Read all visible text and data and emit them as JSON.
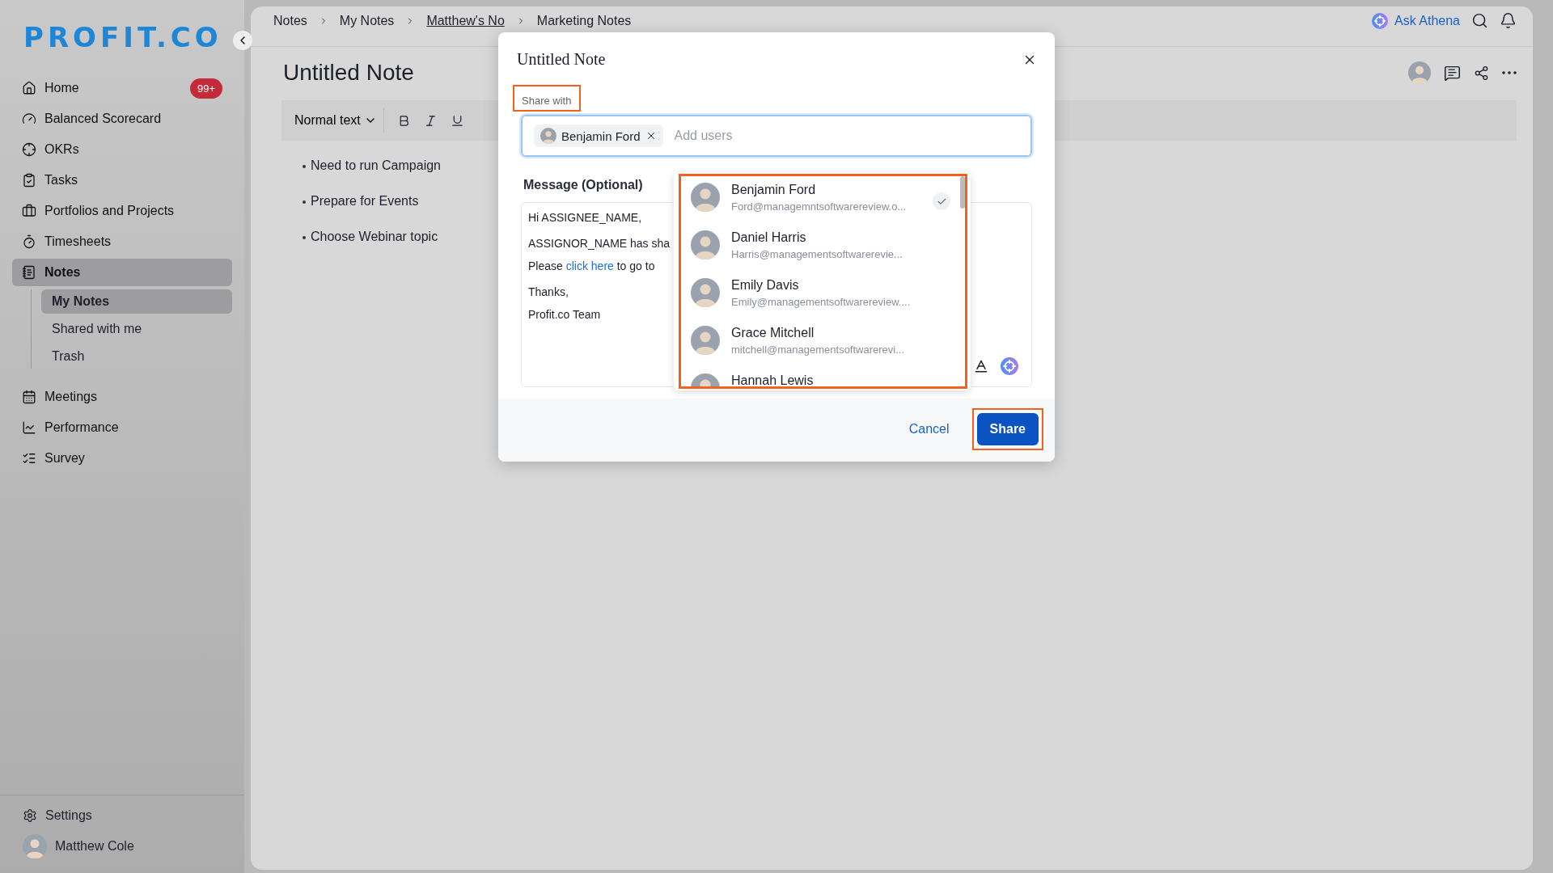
{
  "sidebar": {
    "logo": "PROFIT.CO",
    "items": [
      {
        "label": "Home",
        "badge": "99+",
        "selected": false
      },
      {
        "label": "Balanced Scorecard",
        "selected": false
      },
      {
        "label": "OKRs",
        "selected": false
      },
      {
        "label": "Tasks",
        "selected": false
      },
      {
        "label": "Portfolios and Projects",
        "selected": false
      },
      {
        "label": "Timesheets",
        "selected": false
      },
      {
        "label": "Notes",
        "selected": true,
        "children": [
          {
            "label": "My Notes",
            "selected": true
          },
          {
            "label": "Shared with me",
            "selected": false
          },
          {
            "label": "Trash",
            "selected": false
          }
        ]
      },
      {
        "label": "Meetings",
        "selected": false
      },
      {
        "label": "Performance",
        "selected": false
      },
      {
        "label": "Survey",
        "selected": false
      }
    ],
    "settings": "Settings",
    "user": "Matthew Cole"
  },
  "breadcrumb": [
    {
      "label": "Notes",
      "current": false
    },
    {
      "label": "My Notes",
      "current": false
    },
    {
      "label": "Matthew's No",
      "current": true
    },
    {
      "label": "Marketing Notes",
      "current": false
    }
  ],
  "header": {
    "assistant": "Ask Athena"
  },
  "note": {
    "title": "Untitled Note",
    "format": "Normal text",
    "bullets": [
      "Need to run Campaign",
      "Prepare for Events",
      "Choose Webinar topic"
    ]
  },
  "dialog": {
    "title": "Untitled Note",
    "share_label": "Share with",
    "chips": [
      {
        "name": "Benjamin Ford"
      }
    ],
    "placeholder": "Add users",
    "message_label": "Message (Optional)",
    "message": [
      {
        "lines": [
          {
            "text": "Hi ASSIGNEE_NAME,"
          }
        ]
      },
      {
        "lines": [
          {
            "text": "ASSIGNOR_NAME has sha"
          },
          {
            "text": "Please ",
            "link": "click here",
            "after": " to go to"
          }
        ]
      },
      {
        "lines": [
          {
            "text": "Thanks,"
          },
          {
            "text": "Profit.co Team"
          }
        ]
      }
    ],
    "suggestions": [
      {
        "name": "Benjamin Ford",
        "email": "Ford@managemntsoftwarereview.o...",
        "selected": true
      },
      {
        "name": "Daniel Harris",
        "email": "Harris@managementsoftwarerevie...",
        "selected": false
      },
      {
        "name": "Emily Davis",
        "email": "Emily@managementsoftwarereview....",
        "selected": false
      },
      {
        "name": "Grace Mitchell",
        "email": "mitchell@managementsoftwarerevi...",
        "selected": false
      },
      {
        "name": "Hannah Lewis",
        "selected": false
      }
    ],
    "buttons": {
      "cancel": "Cancel",
      "share": "Share"
    }
  }
}
